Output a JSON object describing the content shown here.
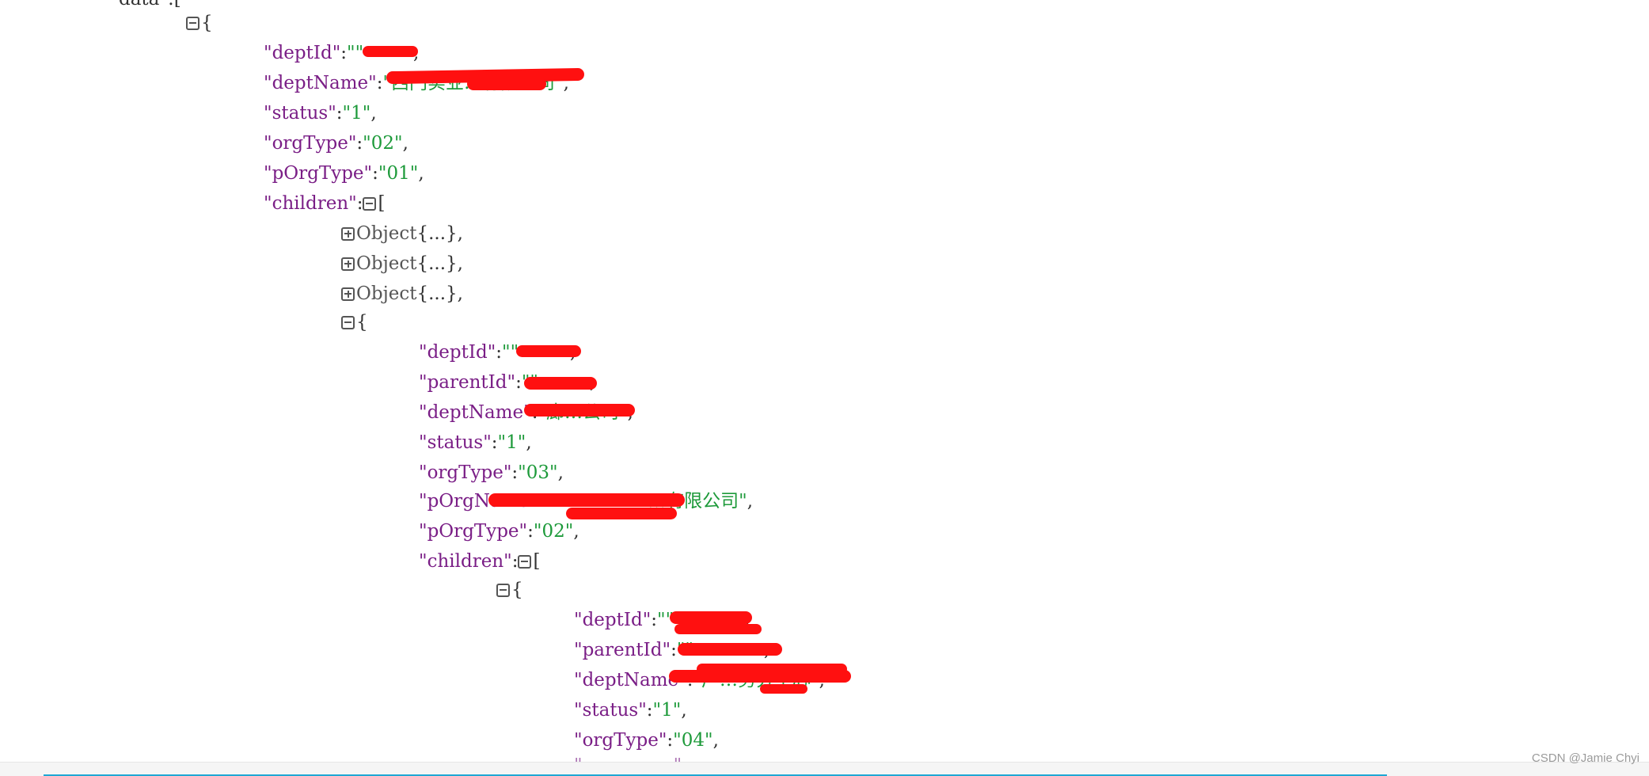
{
  "tree": {
    "top_fragment": "data\":[",
    "root_object": {
      "brace_open": "{",
      "fields": [
        {
          "key": "\"deptId\"",
          "value": "\"\""
        },
        {
          "key": "\"deptName\"",
          "value": "\"西门实业…有限公司\""
        },
        {
          "key": "\"status\"",
          "value": "\"1\""
        },
        {
          "key": "\"orgType\"",
          "value": "\"02\""
        },
        {
          "key": "\"pOrgType\"",
          "value": "\"01\""
        }
      ],
      "children_key": "\"children\"",
      "children_bracket": "[",
      "collapsed_items": [
        {
          "label": "Object",
          "summary": "{...}"
        },
        {
          "label": "Object",
          "summary": "{...}"
        },
        {
          "label": "Object",
          "summary": "{...}"
        }
      ],
      "expanded_child": {
        "brace_open": "{",
        "fields": [
          {
            "key": "\"deptId\"",
            "value": "\"\""
          },
          {
            "key": "\"parentId\"",
            "value": "\"\""
          },
          {
            "key": "\"deptName\"",
            "value": "\"廊…公司\""
          },
          {
            "key": "\"status\"",
            "value": "\"1\""
          },
          {
            "key": "\"orgType\"",
            "value": "\"03\""
          },
          {
            "key": "\"pOrgName",
            "value": "…有限公司\""
          },
          {
            "key": "\"pOrgType\"",
            "value": "\"02\""
          }
        ],
        "children_key": "\"children\"",
        "children_bracket": "[",
        "grandchild": {
          "brace_open": "{",
          "fields": [
            {
              "key": "\"deptId\"",
              "value": "\"\""
            },
            {
              "key": "\"parentId\"",
              "value": "\"\""
            },
            {
              "key": "\"deptName\"",
              "value": "\"广…务分中心\""
            },
            {
              "key": "\"status\"",
              "value": "\"1\""
            },
            {
              "key": "\"orgType\"",
              "value": "\"04\""
            }
          ]
        }
      }
    }
  },
  "footer": {
    "watermark": "CSDN @Jamie Chyi"
  },
  "colors": {
    "key": "#7a1e86",
    "string": "#1d9a3a",
    "redaction": "#ff1010",
    "scroll_line": "#1ea7d4"
  }
}
